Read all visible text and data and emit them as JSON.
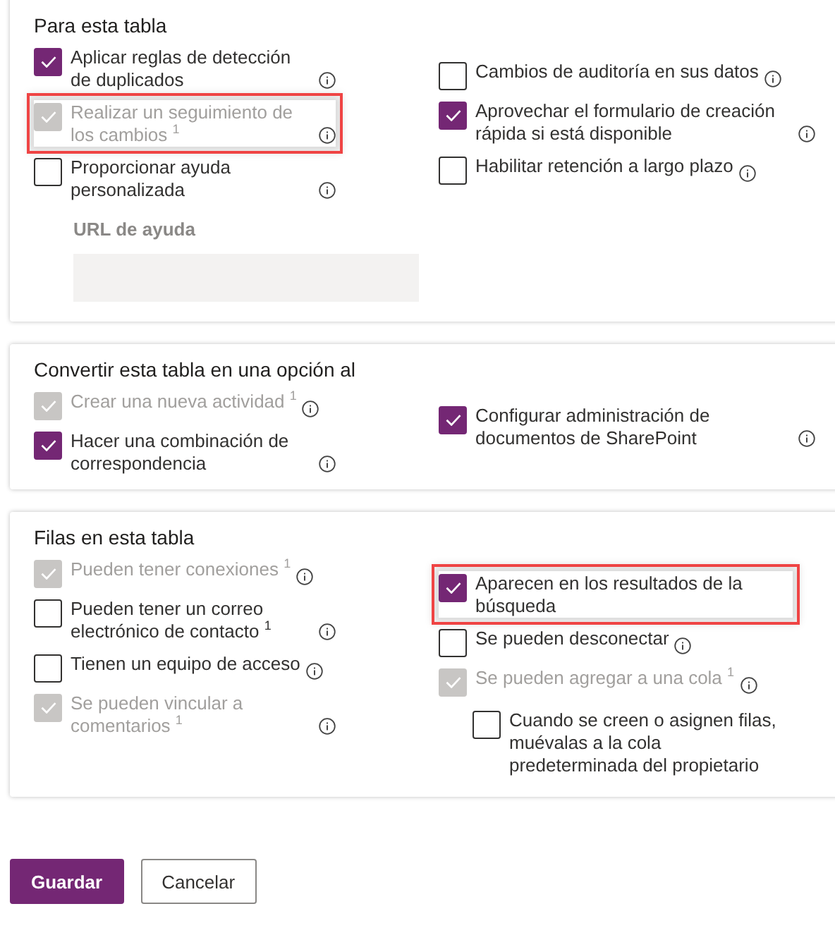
{
  "sections": [
    {
      "title": "Para esta tabla",
      "columns": [
        [
          {
            "kind": "checkbox",
            "label": "Aplicar reglas de detección de duplicados",
            "checked": true,
            "disabled": false,
            "info": true,
            "highlighted": false
          },
          {
            "kind": "checkbox",
            "label": "Realizar un seguimiento de los cambios $^{1}$",
            "checked": true,
            "disabled": true,
            "info": true,
            "highlighted": true
          },
          {
            "kind": "checkbox",
            "label": "Proporcionar ayuda personalizada",
            "checked": false,
            "disabled": false,
            "info": true,
            "highlighted": false
          },
          {
            "kind": "field",
            "label": "URL de ayuda",
            "disabled": true
          }
        ],
        [
          {
            "kind": "checkbox",
            "label": "Cambios de auditoría en sus datos",
            "checked": false,
            "disabled": false,
            "info": true,
            "highlighted": false
          },
          {
            "kind": "checkbox",
            "label": "Aprovechar el formulario de creación rápida si está disponible",
            "checked": true,
            "disabled": false,
            "info": true,
            "highlighted": false
          },
          {
            "kind": "checkbox",
            "label": "Habilitar retención a largo plazo",
            "checked": false,
            "disabled": false,
            "info": true,
            "highlighted": false
          }
        ]
      ]
    },
    {
      "title": "Convertir esta tabla en una opción al",
      "columns": [
        [
          {
            "kind": "checkbox",
            "label": "Crear una nueva actividad $^{1}$",
            "checked": true,
            "disabled": true,
            "info": true,
            "highlighted": false
          },
          {
            "kind": "checkbox",
            "label": "Hacer una combinación de correspondencia",
            "checked": true,
            "disabled": false,
            "info": true,
            "highlighted": false
          }
        ],
        [
          {
            "kind": "checkbox",
            "label": "Configurar administración de documentos de SharePoint",
            "checked": true,
            "disabled": false,
            "info": true,
            "highlighted": false
          }
        ]
      ]
    },
    {
      "title": "Filas en esta tabla",
      "columns": [
        [
          {
            "kind": "checkbox",
            "label": "Pueden tener conexiones $^{1}$",
            "checked": true,
            "disabled": true,
            "info": true,
            "highlighted": false
          },
          {
            "kind": "checkbox",
            "label": "Pueden tener un correo electrónico de contacto $^{1}$",
            "checked": false,
            "disabled": false,
            "info": true,
            "highlighted": false
          },
          {
            "kind": "checkbox",
            "label": "Tienen un equipo de acceso",
            "checked": false,
            "disabled": false,
            "info": true,
            "highlighted": false
          },
          {
            "kind": "checkbox",
            "label": "Se pueden vincular a comentarios $^{1}$",
            "checked": true,
            "disabled": true,
            "info": true,
            "highlighted": false
          }
        ],
        [
          {
            "kind": "checkbox",
            "label": "Aparecen en los resultados de la búsqueda",
            "checked": true,
            "disabled": false,
            "info": false,
            "highlighted": true
          },
          {
            "kind": "checkbox",
            "label": "Se pueden desconectar",
            "checked": false,
            "disabled": false,
            "info": true,
            "highlighted": false
          },
          {
            "kind": "checkbox",
            "label": "Se pueden agregar a una cola $^{1}$",
            "checked": true,
            "disabled": true,
            "info": true,
            "highlighted": false,
            "children": [
              {
                "kind": "checkbox",
                "label": "Cuando se creen o asignen filas, muévalas a la cola predeterminada del propietario",
                "checked": false,
                "disabled": false,
                "info": false,
                "highlighted": false
              }
            ]
          }
        ]
      ]
    }
  ],
  "buttons": [
    {
      "label": "Guardar",
      "kind": "primary"
    },
    {
      "label": "Cancelar",
      "kind": "secondary"
    }
  ]
}
